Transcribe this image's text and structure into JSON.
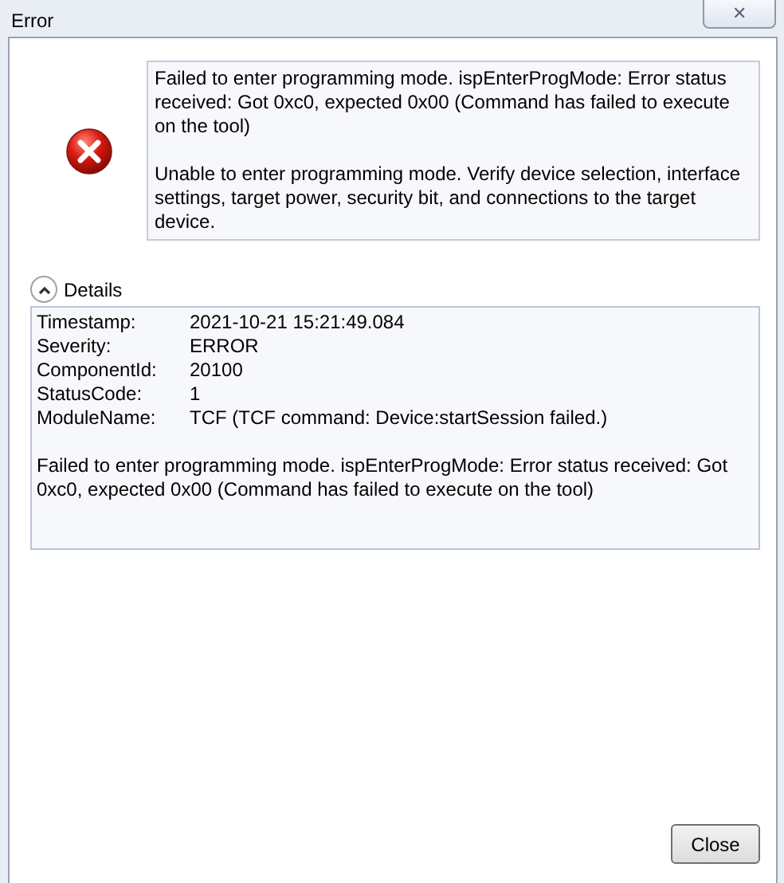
{
  "window": {
    "title": "Error",
    "close_glyph": "✕"
  },
  "message": {
    "paragraphs": [
      "Failed to enter programming mode. ispEnterProgMode: Error status received: Got 0xc0, expected 0x00 (Command has failed to execute on the tool)",
      "Unable to enter programming mode. Verify device selection, interface settings, target power, security bit, and connections to the target device."
    ]
  },
  "details": {
    "label": "Details",
    "expanded": true,
    "fields": [
      {
        "name": "Timestamp:",
        "value": "2021-10-21 15:21:49.084"
      },
      {
        "name": "Severity:",
        "value": "ERROR"
      },
      {
        "name": "ComponentId:",
        "value": "20100"
      },
      {
        "name": "StatusCode:",
        "value": "1"
      },
      {
        "name": "ModuleName:",
        "value": "TCF (TCF command: Device:startSession failed.)"
      }
    ],
    "text": "Failed to enter programming mode. ispEnterProgMode: Error status received: Got 0xc0, expected 0x00 (Command has failed to execute on the tool)"
  },
  "buttons": [
    {
      "label": "Close"
    }
  ]
}
